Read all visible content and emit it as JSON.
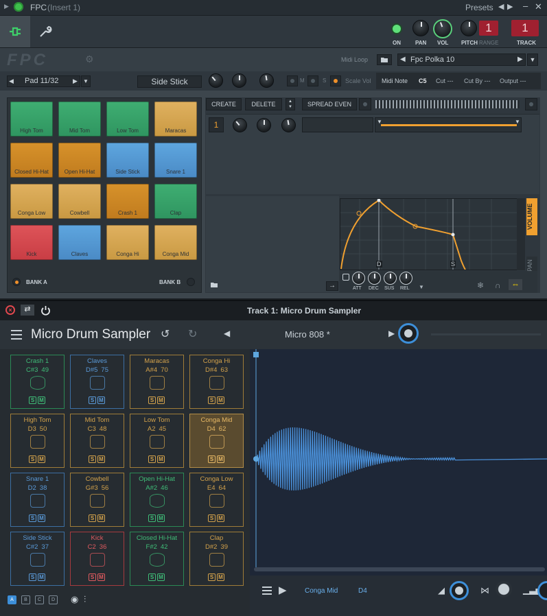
{
  "fpc": {
    "title": "FPC",
    "insert": "(Insert 1)",
    "presets_label": "Presets",
    "toolbar": {
      "on_label": "ON",
      "pan_label": "PAN",
      "vol_label": "VOL",
      "pitch_label": "PITCH",
      "range_label": "RANGE",
      "range_value": "1",
      "track_label": "TRACK",
      "track_value": "1"
    },
    "logo_text": "FPC",
    "midi_loop_label": "Midi Loop",
    "kit_name": "Fpc Polka 10",
    "pad_selector": "Pad 11/32",
    "pad_name": "Side Stick",
    "mute_label": "M",
    "solo_label": "S",
    "scale_vol_label": "Scale Vol",
    "midi_note_label": "Midi Note",
    "midi_note_value": "C5",
    "cut_label": "Cut ---",
    "cut_by_label": "Cut By ---",
    "output_label": "Output ---",
    "pads": [
      {
        "label": "High Tom",
        "color": "green"
      },
      {
        "label": "Mid Tom",
        "color": "green"
      },
      {
        "label": "Low Tom",
        "color": "green"
      },
      {
        "label": "Maracas",
        "color": "tan"
      },
      {
        "label": "Closed Hi-Hat",
        "color": "orange"
      },
      {
        "label": "Open Hi-Hat",
        "color": "orange"
      },
      {
        "label": "Side Stick",
        "color": "blue"
      },
      {
        "label": "Snare 1",
        "color": "blue"
      },
      {
        "label": "Conga Low",
        "color": "tan"
      },
      {
        "label": "Cowbell",
        "color": "tan"
      },
      {
        "label": "Crash 1",
        "color": "orange"
      },
      {
        "label": "Clap",
        "color": "green"
      },
      {
        "label": "Kick",
        "color": "red"
      },
      {
        "label": "Claves",
        "color": "blue"
      },
      {
        "label": "Conga Hi",
        "color": "tan"
      },
      {
        "label": "Conga Mid",
        "color": "tan"
      }
    ],
    "bank_a": "BANK A",
    "bank_b": "BANK B",
    "layer_buttons": {
      "create": "CREATE",
      "delete": "DELETE",
      "spread_even": "SPREAD EVEN"
    },
    "layer_number": "1",
    "envelope": {
      "tabs": [
        "VOLUME",
        "PAN"
      ],
      "knob_labels": [
        "ATT",
        "DEC",
        "SUS",
        "REL"
      ],
      "markers": [
        "D",
        "S"
      ]
    }
  },
  "mds": {
    "window_title": "Track 1: Micro Drum Sampler",
    "app_name": "Micro Drum Sampler",
    "preset_name": "Micro 808 *",
    "cells": [
      {
        "name": "Crash 1",
        "note": "C#3",
        "num": "49",
        "color": "green",
        "icon": "cymbal-icon"
      },
      {
        "name": "Claves",
        "note": "D#5",
        "num": "75",
        "color": "blue",
        "icon": "claves-icon"
      },
      {
        "name": "Maracas",
        "note": "A#4",
        "num": "70",
        "color": "tan",
        "icon": "maracas-icon"
      },
      {
        "name": "Conga Hi",
        "note": "D#4",
        "num": "63",
        "color": "tan",
        "icon": "conga-icon"
      },
      {
        "name": "High Tom",
        "note": "D3",
        "num": "50",
        "color": "tan",
        "icon": "tom-icon"
      },
      {
        "name": "Mid Tom",
        "note": "C3",
        "num": "48",
        "color": "tan",
        "icon": "tom-icon"
      },
      {
        "name": "Low Tom",
        "note": "A2",
        "num": "45",
        "color": "tan",
        "icon": "tom-icon"
      },
      {
        "name": "Conga Mid",
        "note": "D4",
        "num": "62",
        "color": "tanhi",
        "icon": "conga-icon"
      },
      {
        "name": "Snare 1",
        "note": "D2",
        "num": "38",
        "color": "blue",
        "icon": "snare-icon"
      },
      {
        "name": "Cowbell",
        "note": "G#3",
        "num": "56",
        "color": "tan",
        "icon": "cowbell-icon"
      },
      {
        "name": "Open Hi-Hat",
        "note": "A#2",
        "num": "46",
        "color": "green",
        "icon": "hihat-icon"
      },
      {
        "name": "Conga Low",
        "note": "E4",
        "num": "64",
        "color": "tan",
        "icon": "conga-icon"
      },
      {
        "name": "Side Stick",
        "note": "C#2",
        "num": "37",
        "color": "blue",
        "icon": "snare-icon"
      },
      {
        "name": "Kick",
        "note": "C2",
        "num": "36",
        "color": "red",
        "icon": "kick-icon"
      },
      {
        "name": "Closed Hi-Hat",
        "note": "F#2",
        "num": "42",
        "color": "green",
        "icon": "hihat-icon"
      },
      {
        "name": "Clap",
        "note": "D#2",
        "num": "39",
        "color": "tan",
        "icon": "clap-icon"
      }
    ],
    "solo_label": "S",
    "mute_label": "M",
    "banks": [
      "A",
      "B",
      "C",
      "D"
    ],
    "bottom": {
      "pad_name": "Conga Mid",
      "note": "D4"
    }
  }
}
